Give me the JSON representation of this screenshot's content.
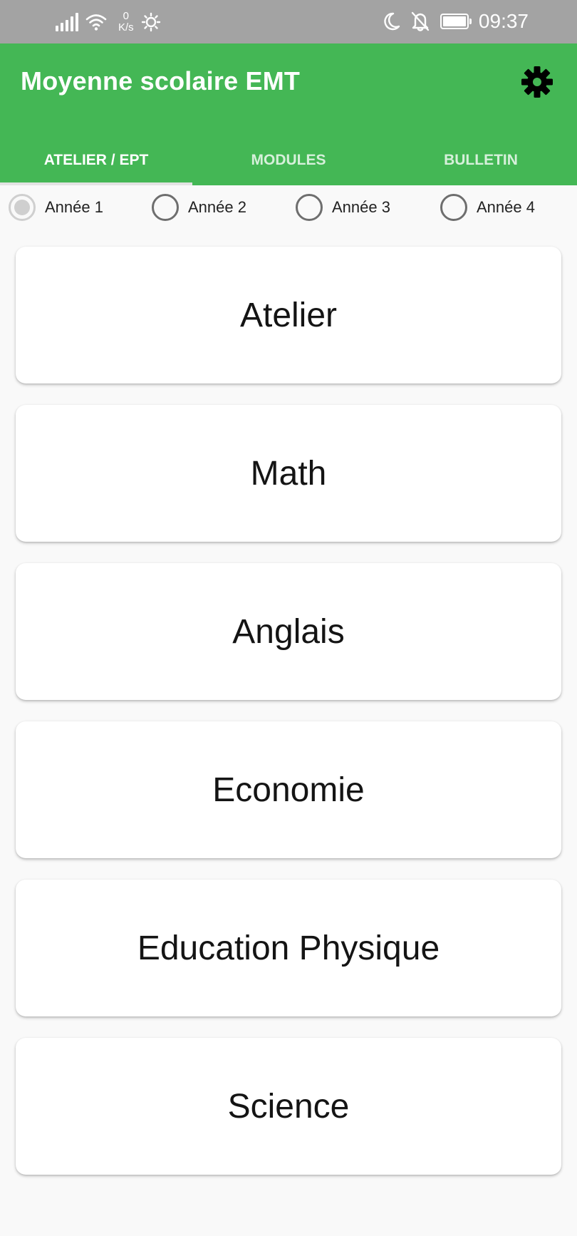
{
  "status_bar": {
    "net_speed_value": "0",
    "net_speed_unit": "K/s",
    "time": "09:37"
  },
  "app_bar": {
    "title": "Moyenne scolaire EMT",
    "settings_icon": "gear-icon",
    "background_color": "#44b755"
  },
  "tabs": [
    {
      "label": "ATELIER / EPT",
      "active": true
    },
    {
      "label": "MODULES",
      "active": false
    },
    {
      "label": "BULLETIN",
      "active": false
    }
  ],
  "years": [
    {
      "label": "Année 1",
      "selected": true
    },
    {
      "label": "Année 2",
      "selected": false
    },
    {
      "label": "Année 3",
      "selected": false
    },
    {
      "label": "Année 4",
      "selected": false
    }
  ],
  "subjects": [
    {
      "label": "Atelier"
    },
    {
      "label": "Math"
    },
    {
      "label": "Anglais"
    },
    {
      "label": "Economie"
    },
    {
      "label": "Education Physique"
    },
    {
      "label": "Science"
    }
  ]
}
